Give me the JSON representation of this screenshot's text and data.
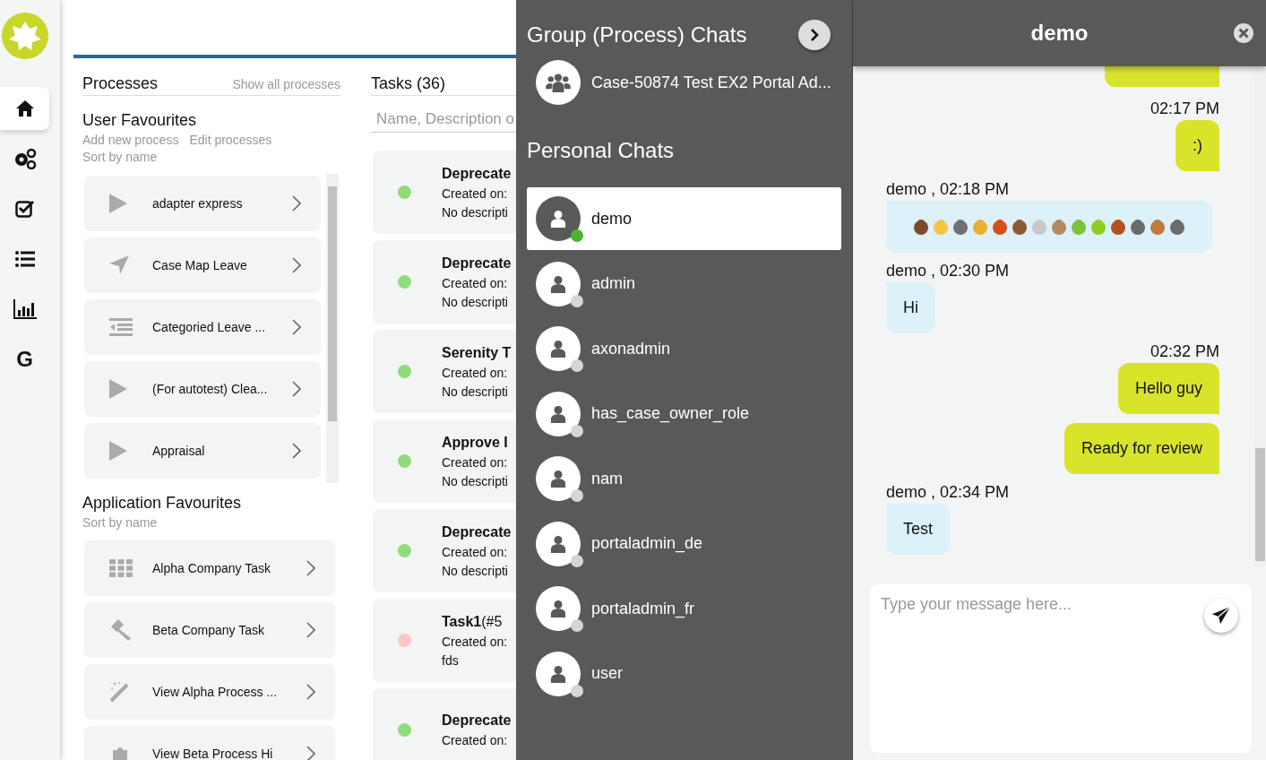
{
  "nav": {
    "items": [
      {
        "kind": "home",
        "selected": true
      },
      {
        "kind": "gears",
        "selected": false
      },
      {
        "kind": "check",
        "selected": false
      },
      {
        "kind": "list",
        "selected": false
      },
      {
        "kind": "chart",
        "selected": false
      },
      {
        "kind": "text",
        "label": "G",
        "selected": false
      }
    ]
  },
  "processes": {
    "title": "Processes",
    "show_all": "Show all processes",
    "user_favourites": {
      "title": "User Favourites",
      "links": [
        "Add new process",
        "Edit processes"
      ],
      "sort": "Sort by name",
      "items": [
        {
          "kind": "play",
          "name": "adapter express"
        },
        {
          "kind": "navigate",
          "name": "Case Map Leave"
        },
        {
          "kind": "indent",
          "name": "Categoried Leave ..."
        },
        {
          "kind": "play",
          "name": "(For autotest) Clea..."
        },
        {
          "kind": "play",
          "name": "Appraisal"
        }
      ]
    },
    "app_favourites": {
      "title": "Application Favourites",
      "sort": "Sort by name",
      "items": [
        {
          "kind": "grid",
          "name": "Alpha Company Task"
        },
        {
          "kind": "gavel",
          "name": "Beta Company Task"
        },
        {
          "kind": "wand",
          "name": "View Alpha Process ..."
        },
        {
          "kind": "puzzle",
          "name": "View Beta Process Hi"
        }
      ]
    }
  },
  "tasks": {
    "title": "Tasks (36)",
    "search_placeholder": "Name, Description o",
    "items": [
      {
        "color": "#8fdc7c",
        "title": "Deprecate",
        "created": "Created on:",
        "description": "No descripti"
      },
      {
        "color": "#8fdc7c",
        "title": "Deprecate",
        "created": "Created on:",
        "description": "No descripti"
      },
      {
        "color": "#8fdc7c",
        "title": "Serenity T",
        "created": "Created on:",
        "description": "No descripti"
      },
      {
        "color": "#8fdc7c",
        "title": "Approve I",
        "created": "Created on:",
        "description": "No descripti"
      },
      {
        "color": "#8fdc7c",
        "title": "Deprecate",
        "created": "Created on:",
        "description": "No descripti"
      },
      {
        "color": "#ffc4c4",
        "title": "Task1",
        "number": "(#5",
        "created": "Created on:",
        "description": "fds"
      },
      {
        "color": "#8fdc7c",
        "title": "Deprecate",
        "created": "Created on:"
      }
    ]
  },
  "chat_list": {
    "group_title": "Group (Process) Chats",
    "groups": [
      {
        "name": "Case-50874 Test EX2 Portal Ad..."
      }
    ],
    "personal_title": "Personal Chats",
    "contacts": [
      {
        "name": "demo",
        "selected": true,
        "online": true
      },
      {
        "name": "admin",
        "selected": false,
        "online": false
      },
      {
        "name": "axonadmin",
        "selected": false,
        "online": false
      },
      {
        "name": "has_case_owner_role",
        "selected": false,
        "online": false
      },
      {
        "name": "nam",
        "selected": false,
        "online": false
      },
      {
        "name": "portaladmin_de",
        "selected": false,
        "online": false
      },
      {
        "name": "portaladmin_fr",
        "selected": false,
        "online": false
      },
      {
        "name": "user",
        "selected": false,
        "online": false
      }
    ]
  },
  "chat": {
    "title": "demo",
    "messages": [
      {
        "outgoing": true,
        "kind": "partial"
      },
      {
        "outgoing": true,
        "meta": "02:17 PM",
        "kind": "text",
        "text": ":)"
      },
      {
        "outgoing": false,
        "meta": "demo , 02:18 PM",
        "kind": "emoji",
        "emojis": [
          {
            "color": "#7b4a2d"
          },
          {
            "color": "#f5c542"
          },
          {
            "color": "#707070"
          },
          {
            "color": "#e8b030"
          },
          {
            "color": "#d4501a"
          },
          {
            "color": "#8a5a30"
          },
          {
            "color": "#c8c8c8"
          },
          {
            "color": "#b08a60"
          },
          {
            "color": "#7cc23a"
          },
          {
            "color": "#8ccf1e"
          },
          {
            "color": "#b5501e"
          },
          {
            "color": "#6a6a6a"
          },
          {
            "color": "#c07a40"
          },
          {
            "color": "#6b6b6b"
          }
        ]
      },
      {
        "outgoing": false,
        "meta": "demo , 02:30 PM",
        "kind": "text",
        "text": "Hi"
      },
      {
        "outgoing": true,
        "meta": "02:32 PM",
        "kind": "text",
        "text": "Hello guy"
      },
      {
        "outgoing": true,
        "kind": "text",
        "text": "Ready for review"
      },
      {
        "outgoing": false,
        "meta": "demo , 02:34 PM",
        "kind": "text",
        "text": "Test"
      }
    ],
    "input_placeholder": "Type your message here..."
  }
}
